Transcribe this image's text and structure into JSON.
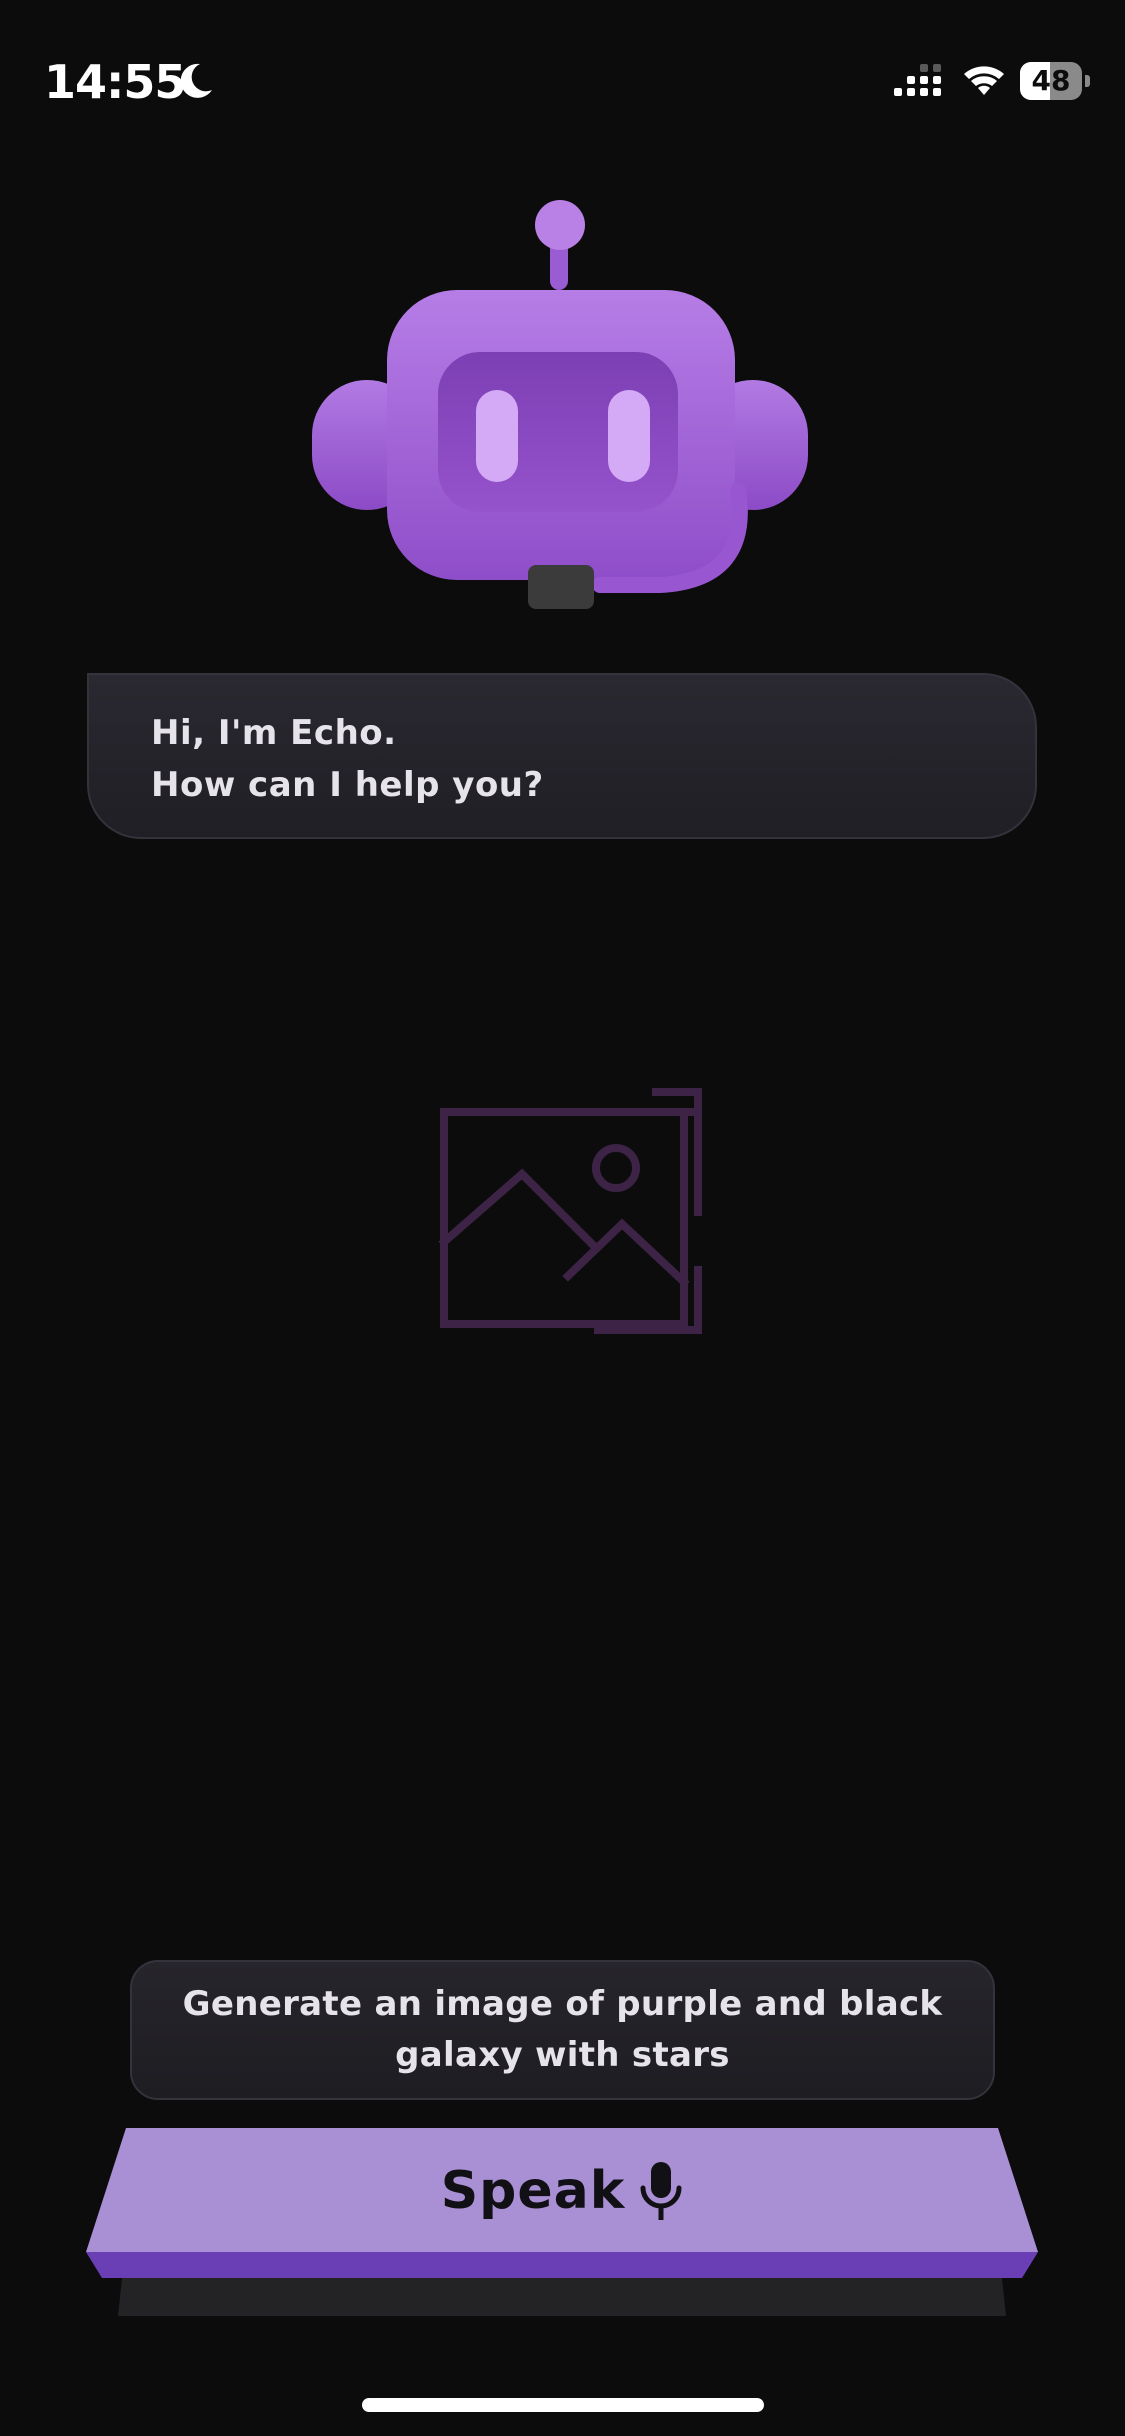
{
  "status_bar": {
    "time": "14:55",
    "battery_level": "48",
    "battery_fraction": 0.48,
    "icons": [
      "moon-icon",
      "cellular-signal-icon",
      "wifi-icon",
      "battery-icon"
    ]
  },
  "assistant": {
    "avatar_icon": "robot-icon",
    "greeting_line_1": "Hi, I'm Echo.",
    "greeting_line_2": "How can I help you?"
  },
  "result": {
    "placeholder_icon": "image-placeholder-icon"
  },
  "suggestion": {
    "text": "Generate an image of purple and black galaxy with stars"
  },
  "speak_button": {
    "label": "Speak",
    "icon": "microphone-icon"
  },
  "colors": {
    "background": "#0c0c0d",
    "accent_purple": "#a98fd3",
    "button_edge": "#6a3fb5",
    "robot_purple": "#a865dc",
    "placeholder_purple": "#3d2346"
  }
}
